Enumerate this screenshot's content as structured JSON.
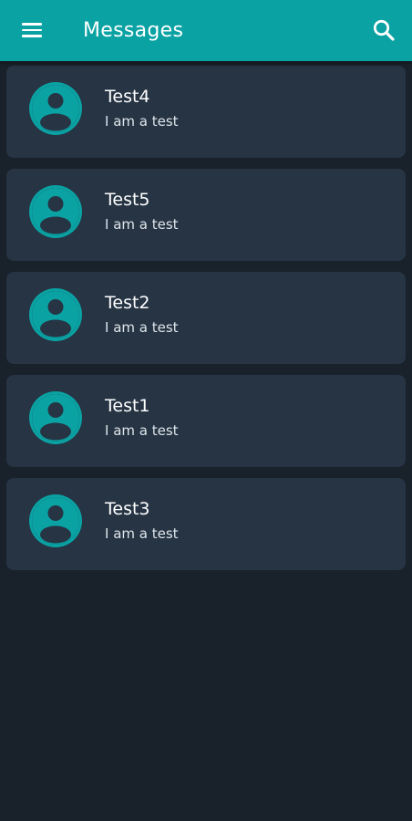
{
  "colors": {
    "appbar": "#0aa2a3",
    "background": "#19212b",
    "card": "#263444",
    "avatar": "#0aa2a3"
  },
  "header": {
    "menu_icon": "hamburger-menu-icon",
    "title": "Messages",
    "search_icon": "search-icon"
  },
  "conversations": [
    {
      "name": "Test4",
      "preview": "I am a test",
      "avatar_icon": "person-avatar-icon"
    },
    {
      "name": "Test5",
      "preview": "I am a test",
      "avatar_icon": "person-avatar-icon"
    },
    {
      "name": "Test2",
      "preview": "I am a test",
      "avatar_icon": "person-avatar-icon"
    },
    {
      "name": "Test1",
      "preview": "I am a test",
      "avatar_icon": "person-avatar-icon"
    },
    {
      "name": "Test3",
      "preview": "I am a test",
      "avatar_icon": "person-avatar-icon"
    }
  ]
}
